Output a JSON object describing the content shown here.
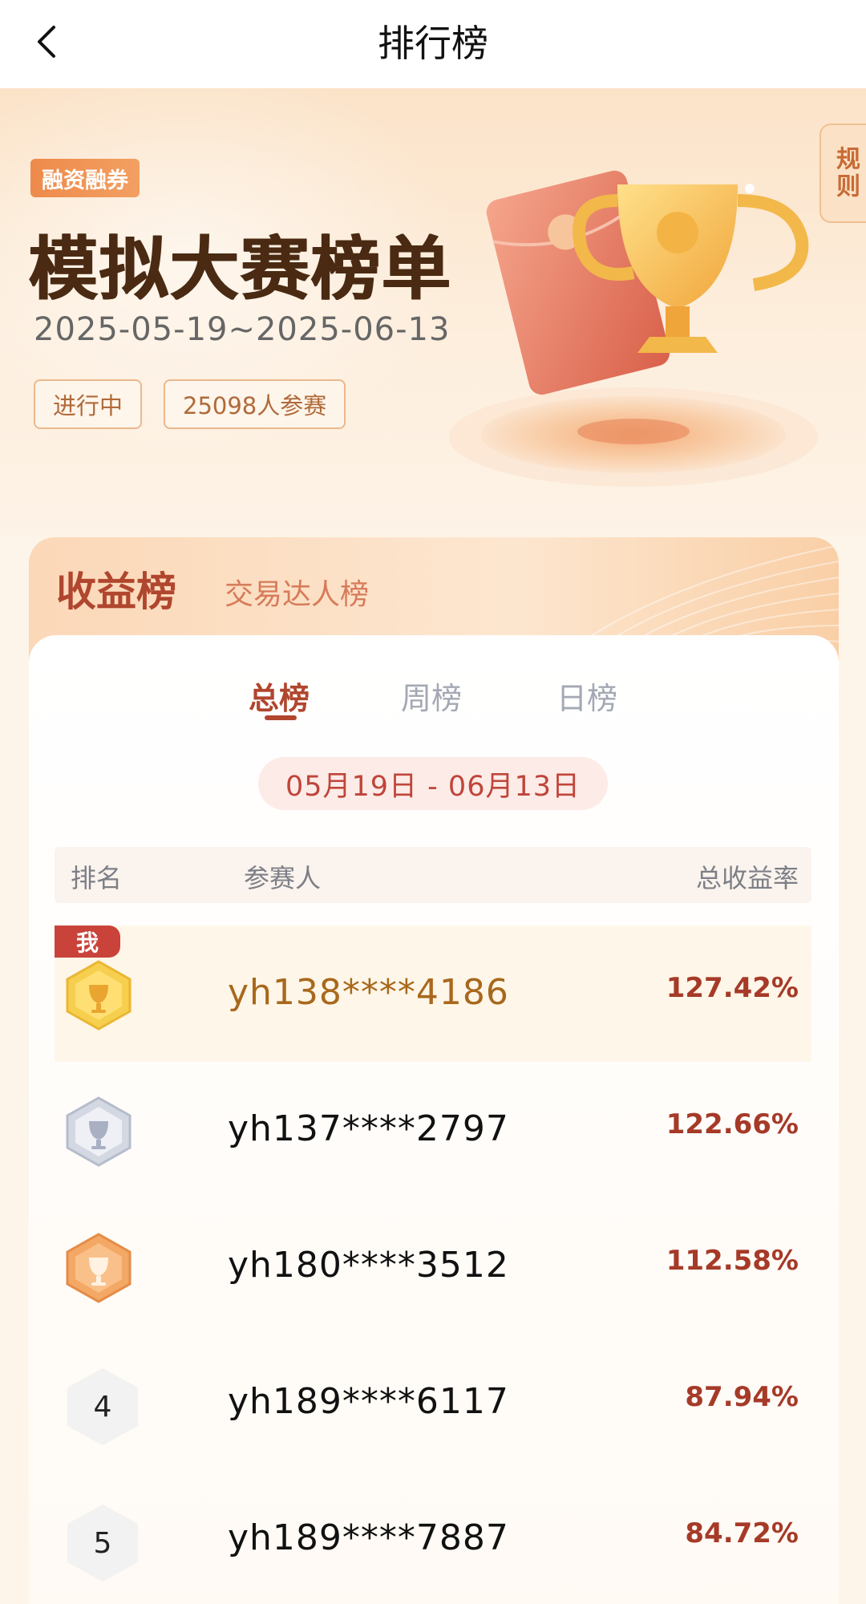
{
  "nav": {
    "title": "排行榜"
  },
  "hero": {
    "tag": "融资融券",
    "title": "模拟大赛榜单",
    "date_range": "2025-05-19~2025-06-13",
    "status": "进行中",
    "participants": "25098人参赛",
    "rules_label": "规则"
  },
  "board": {
    "tabs": [
      {
        "label": "收益榜",
        "active": true
      },
      {
        "label": "交易达人榜",
        "active": false
      }
    ],
    "subtabs": [
      {
        "label": "总榜",
        "active": true
      },
      {
        "label": "周榜",
        "active": false
      },
      {
        "label": "日榜",
        "active": false
      }
    ],
    "date_range": "05月19日 - 06月13日",
    "headers": {
      "rank": "排名",
      "name": "参赛人",
      "rate": "总收益率"
    },
    "me_label": "我",
    "rows": [
      {
        "rank": "",
        "medal": "gold",
        "name": "yh138****4186",
        "rate": "127.42%",
        "is_me": true
      },
      {
        "rank": "",
        "medal": "silver",
        "name": "yh137****2797",
        "rate": "122.66%"
      },
      {
        "rank": "",
        "medal": "bronze",
        "name": "yh180****3512",
        "rate": "112.58%"
      },
      {
        "rank": "4",
        "name": "yh189****6117",
        "rate": "87.94%"
      },
      {
        "rank": "5",
        "name": "yh189****7887",
        "rate": "84.72%"
      }
    ]
  },
  "colors": {
    "accent": "#b0462e",
    "gold": "#f0c040",
    "silver": "#c7ccd8",
    "bronze": "#f0a060"
  }
}
